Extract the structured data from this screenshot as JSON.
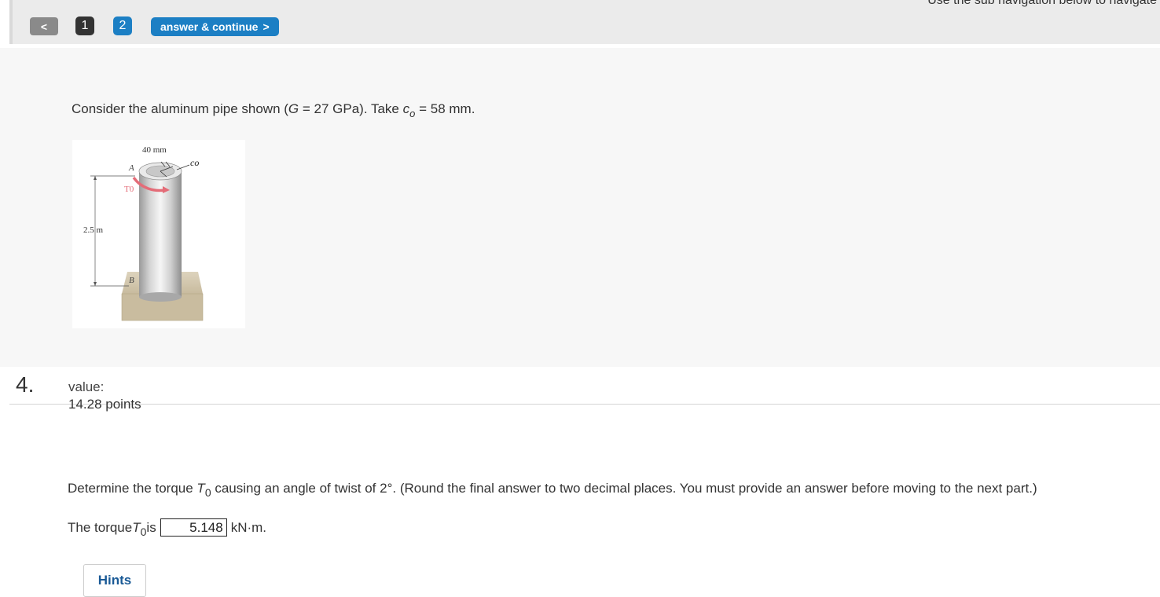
{
  "nav": {
    "subnav_hint": "Use the sub navigation below to navigate",
    "back_label": "<",
    "part1": "1",
    "part2": "2",
    "answer_continue": "answer & continue",
    "answer_chevron": ">"
  },
  "intro": {
    "prefix": "Consider the aluminum pipe shown (",
    "g_symbol": "G",
    "g_value": " = 27 GPa). Take ",
    "c_symbol": "c",
    "c_sub": "o",
    "c_value": " = 58 mm."
  },
  "figure": {
    "dim_top": "40 mm",
    "co_label": "co",
    "point_a": "A",
    "torque_label": "T0",
    "length_label": "2.5 m",
    "point_b": "B"
  },
  "question": {
    "number": "4.",
    "value_label": "value:",
    "points": "14.28 points",
    "prompt_start": "Determine the torque ",
    "t_symbol": "T",
    "t_sub": "0",
    "prompt_end": " causing an angle of twist of 2°. (Round the final answer to two decimal places. You must provide an answer before moving to the next part.)",
    "answer_prefix": "The torque ",
    "answer_is": " is",
    "answer_value": "5.148",
    "answer_unit": "kN·m."
  },
  "hints_label": "Hints",
  "colors": {
    "accent": "#1c7fc4",
    "torque_arrow": "#e46c78",
    "base": "#cfc3a8"
  }
}
